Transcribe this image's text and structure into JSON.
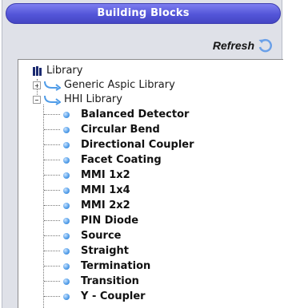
{
  "panel": {
    "title": "Building Blocks"
  },
  "toolbar": {
    "refresh_label": "Refresh"
  },
  "tree": {
    "root": "Library",
    "libraries": [
      {
        "label": "Generic Aspic Library",
        "expanded": false
      },
      {
        "label": "HHI Library",
        "expanded": true
      }
    ],
    "items": [
      "Balanced Detector",
      "Circular Bend",
      "Directional Coupler",
      "Facet Coating",
      "MMI 1x2",
      "MMI 1x4",
      "MMI 2x2",
      "PIN Diode",
      "Source",
      "Straight",
      "Termination",
      "Transition",
      "Y - Coupler"
    ]
  },
  "colors": {
    "titlebar": "#5355d8",
    "bullet": "#4f9ce8",
    "panel_bg": "#dfe1e8"
  }
}
